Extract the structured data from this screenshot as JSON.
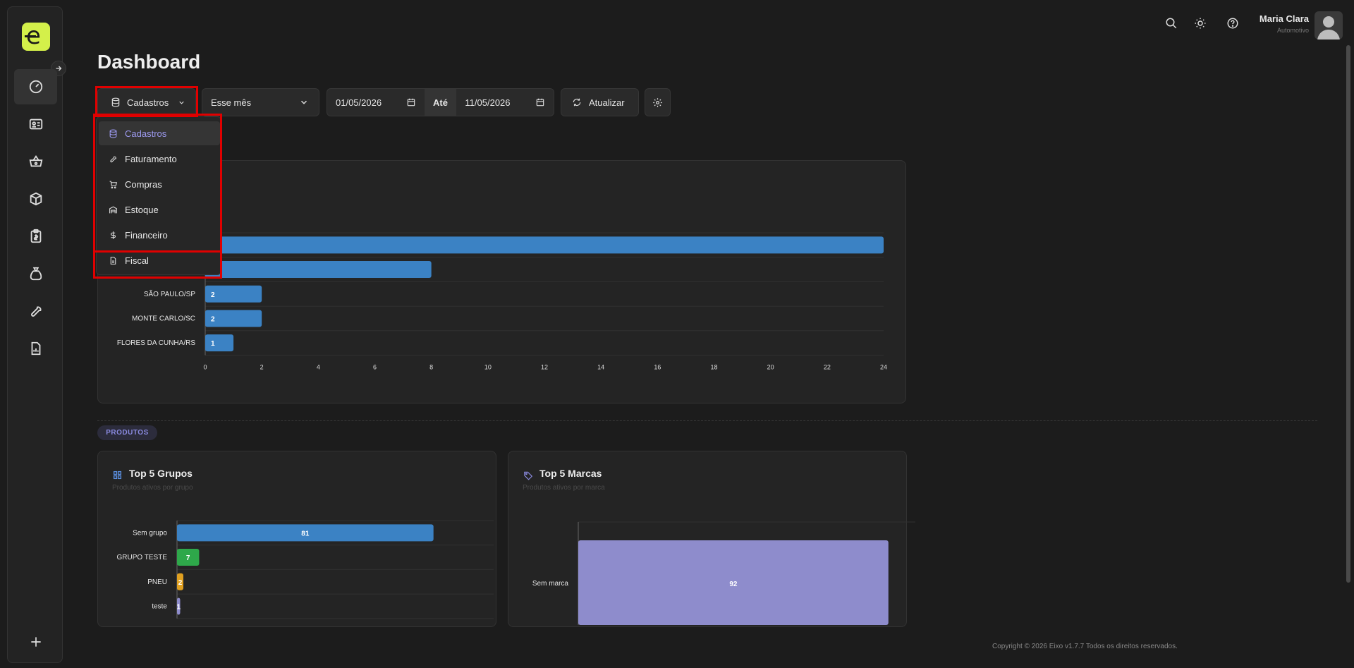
{
  "header": {
    "title": "Dashboard",
    "user_name": "Maria Clara",
    "user_role": "Automotivo"
  },
  "toolbar": {
    "module_select": "Cadastros",
    "period_select": "Esse mês",
    "date_from": "01/05/2026",
    "date_separator": "Até",
    "date_to": "11/05/2026",
    "refresh_label": "Atualizar"
  },
  "dropdown": {
    "items": [
      {
        "label": "Cadastros",
        "icon": "database-icon",
        "active": true
      },
      {
        "label": "Faturamento",
        "icon": "wrench-icon"
      },
      {
        "label": "Compras",
        "icon": "cart-icon"
      },
      {
        "label": "Estoque",
        "icon": "warehouse-icon"
      },
      {
        "label": "Financeiro",
        "icon": "dollar-icon"
      },
      {
        "label": "Fiscal",
        "icon": "file-icon"
      }
    ]
  },
  "sections": {
    "produtos_label": "PRODUTOS"
  },
  "cards": {
    "top_grupos": {
      "title": "Top 5 Grupos",
      "subtitle": "Produtos ativos por grupo"
    },
    "top_marcas": {
      "title": "Top 5 Marcas",
      "subtitle": "Produtos ativos por marca"
    }
  },
  "footer": {
    "text": "Copyright © 2026 Eixo v1.7.7 Todos os direitos reservados."
  },
  "colors": {
    "accent": "#d4f04a",
    "bar_blue": "#3b82c4",
    "bar_green": "#2ea84a",
    "bar_orange": "#e0a020",
    "bar_purple": "#8e8ccc",
    "highlight_red": "#e00000"
  },
  "chart_data": [
    {
      "type": "bar",
      "orientation": "horizontal",
      "categories": [
        "",
        "",
        "SÃO PAULO/SP",
        "MONTE CARLO/SC",
        "FLORES DA CUNHA/RS"
      ],
      "values": [
        24,
        8,
        2,
        2,
        1
      ],
      "value_labels": [
        "",
        "",
        "2",
        "2",
        "1"
      ],
      "xlim": [
        0,
        24
      ],
      "xticks": [
        0,
        2,
        4,
        6,
        8,
        10,
        12,
        14,
        16,
        18,
        20,
        22,
        24
      ],
      "grid": true
    },
    {
      "type": "bar",
      "orientation": "horizontal",
      "categories": [
        "Sem grupo",
        "GRUPO TESTE",
        "PNEU",
        "teste"
      ],
      "values": [
        81,
        7,
        2,
        1
      ],
      "value_labels": [
        "81",
        "7",
        "2",
        "1"
      ],
      "colors": [
        "#3b82c4",
        "#2ea84a",
        "#e0a020",
        "#8e8ccc"
      ],
      "xlim": [
        0,
        100
      ]
    },
    {
      "type": "bar",
      "orientation": "horizontal",
      "categories": [
        "Sem marca"
      ],
      "values": [
        92
      ],
      "value_labels": [
        "92"
      ],
      "colors": [
        "#8e8ccc"
      ],
      "xlim": [
        0,
        100
      ]
    }
  ]
}
